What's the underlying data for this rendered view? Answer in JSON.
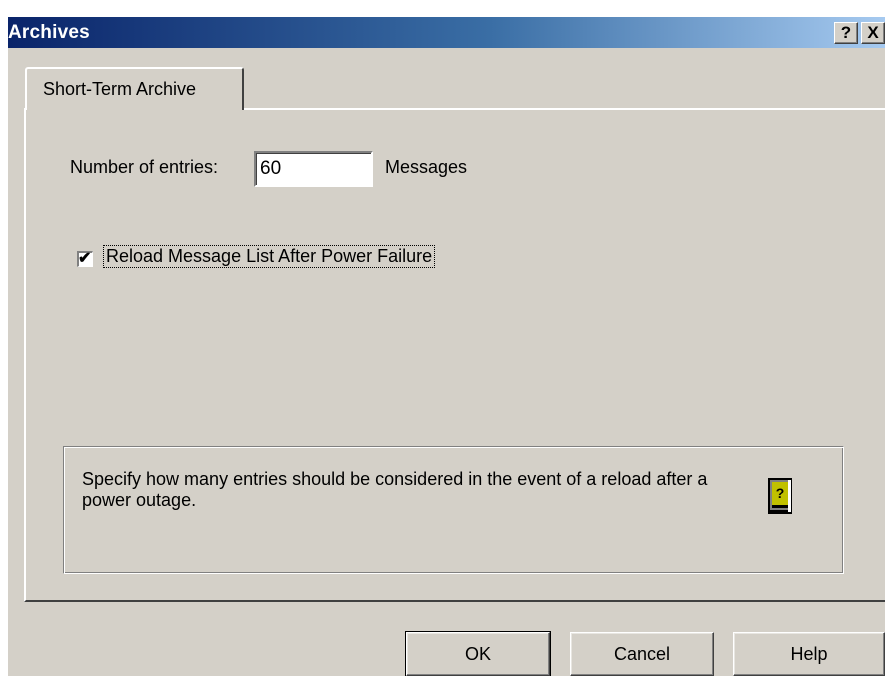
{
  "window": {
    "title": "Archives"
  },
  "titlebar_buttons": {
    "help": "?",
    "close": "X"
  },
  "tabs": [
    {
      "label": "Short-Term Archive",
      "active": true
    }
  ],
  "entries": {
    "label": "Number of entries:",
    "value": "60",
    "unit": "Messages"
  },
  "reload_option": {
    "label": "Reload Message List After Power Failure",
    "checked": true
  },
  "info": {
    "text": "Specify how many entries should be considered in the event of a reload after a power outage.",
    "icon": "help-book-icon"
  },
  "buttons": {
    "ok": "OK",
    "cancel": "Cancel",
    "help": "Help"
  },
  "colors": {
    "face": "#d4d0c8",
    "title_start": "#0a246a",
    "title_end": "#a6caf0"
  }
}
